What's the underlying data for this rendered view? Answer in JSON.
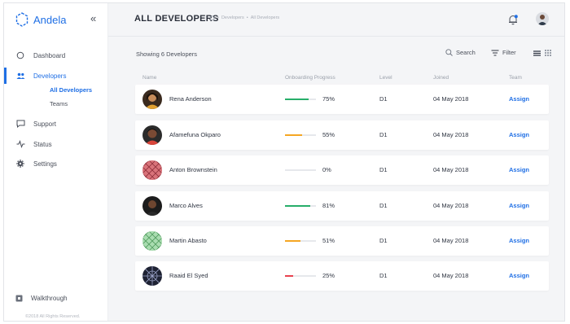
{
  "brand": {
    "name": "Andela",
    "accent": "#1f6fe5"
  },
  "sidebar": {
    "collapse_glyph": "«",
    "items": [
      {
        "label": "Dashboard",
        "icon": "circle-icon"
      },
      {
        "label": "Developers",
        "icon": "people-icon",
        "active": true
      },
      {
        "label": "Support",
        "icon": "chat-icon"
      },
      {
        "label": "Status",
        "icon": "status-icon"
      },
      {
        "label": "Settings",
        "icon": "gear-icon"
      }
    ],
    "sub_items": [
      {
        "label": "All Developers",
        "active": true
      },
      {
        "label": "Teams"
      }
    ],
    "walkthrough": "Walkthrough",
    "copyright": "©2018 All Rights Reserved."
  },
  "header": {
    "title": "ALL DEVELOPERS",
    "breadcrumb": [
      "Developers",
      "All Developers"
    ],
    "breadcrumb_sep": "•"
  },
  "toolbar": {
    "showing": "Showing 6 Developers",
    "search": "Search",
    "filter": "Filter"
  },
  "table": {
    "columns": [
      "Name",
      "Onboarding Progress",
      "Level",
      "Joined",
      "Team"
    ],
    "rows": [
      {
        "name": "Rena Anderson",
        "progress": 75,
        "progress_label": "75%",
        "progress_color": "#27ae6a",
        "level": "D1",
        "joined": "04 May 2018",
        "team": "Assign"
      },
      {
        "name": "Afamefuna Okparo",
        "progress": 55,
        "progress_label": "55%",
        "progress_color": "#f5a623",
        "level": "D1",
        "joined": "04 May 2018",
        "team": "Assign"
      },
      {
        "name": "Anton Brownstein",
        "progress": 0,
        "progress_label": "0%",
        "progress_color": "#e6e8ec",
        "level": "D1",
        "joined": "04 May 2018",
        "team": "Assign"
      },
      {
        "name": "Marco Alves",
        "progress": 81,
        "progress_label": "81%",
        "progress_color": "#27ae6a",
        "level": "D1",
        "joined": "04 May 2018",
        "team": "Assign"
      },
      {
        "name": "Martin Abasto",
        "progress": 51,
        "progress_label": "51%",
        "progress_color": "#f5a623",
        "level": "D1",
        "joined": "04 May 2018",
        "team": "Assign"
      },
      {
        "name": "Raaid El Syed",
        "progress": 25,
        "progress_label": "25%",
        "progress_color": "#e8424f",
        "level": "D1",
        "joined": "04 May 2018",
        "team": "Assign"
      }
    ]
  }
}
